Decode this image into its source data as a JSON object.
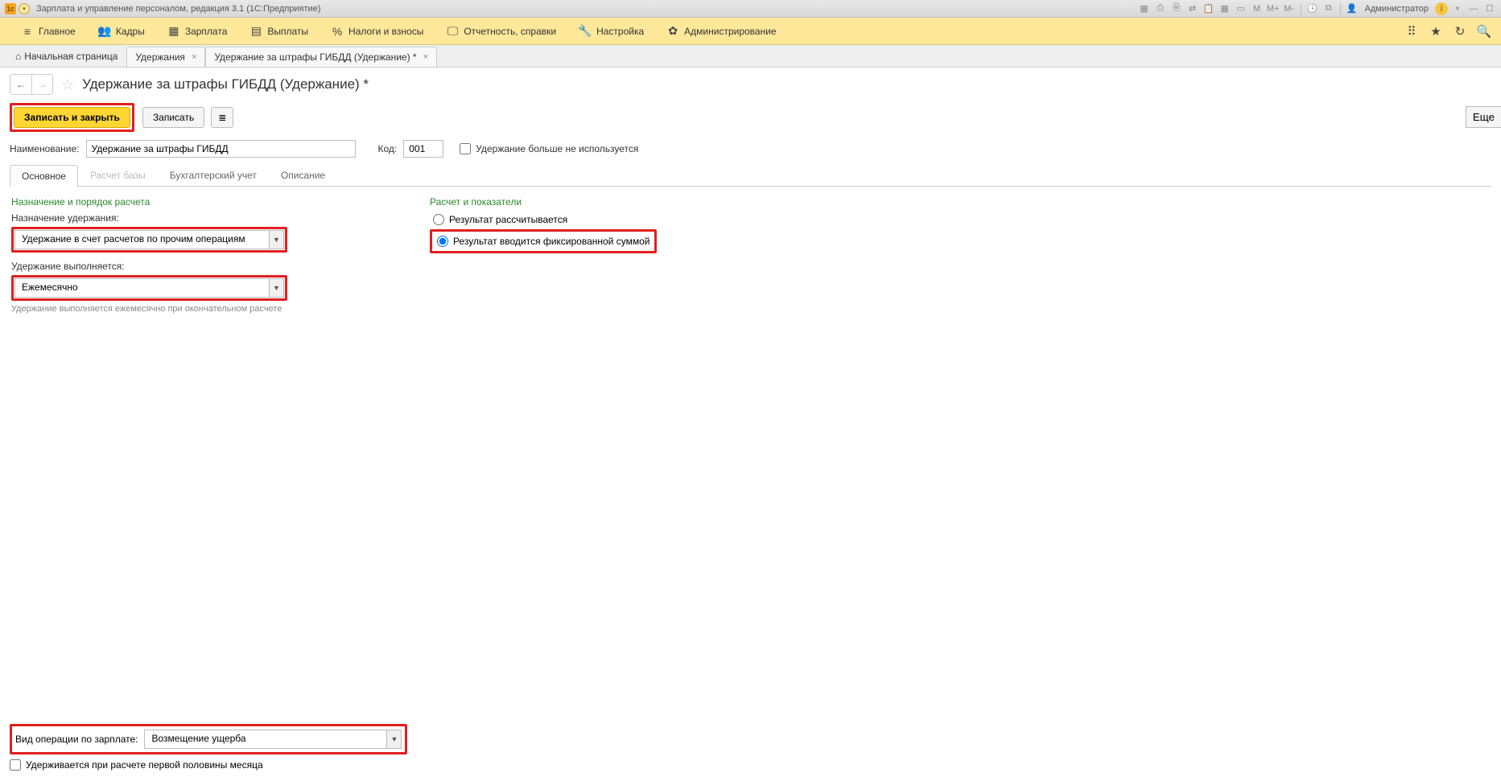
{
  "titlebar": {
    "app_icon_text": "1c",
    "title": "Зарплата и управление персоналом, редакция 3.1  (1С:Предприятие)",
    "user": "Администратор",
    "m_labels": [
      "M",
      "M+",
      "M-"
    ]
  },
  "mainnav": {
    "items": [
      {
        "icon": "≡",
        "label": "Главное"
      },
      {
        "icon": "👥",
        "label": "Кадры"
      },
      {
        "icon": "▦",
        "label": "Зарплата"
      },
      {
        "icon": "▤",
        "label": "Выплаты"
      },
      {
        "icon": "%",
        "label": "Налоги и взносы"
      },
      {
        "icon": "🖵",
        "label": "Отчетность, справки"
      },
      {
        "icon": "🔧",
        "label": "Настройка"
      },
      {
        "icon": "✿",
        "label": "Администрирование"
      }
    ]
  },
  "tabs": {
    "home": "Начальная страница",
    "items": [
      {
        "label": "Удержания"
      },
      {
        "label": "Удержание за штрафы ГИБДД (Удержание) *"
      }
    ]
  },
  "page": {
    "title": "Удержание за штрафы ГИБДД (Удержание) *",
    "more": "Еще"
  },
  "toolbar": {
    "save_close": "Записать и закрыть",
    "save": "Записать",
    "list_icon": "≣"
  },
  "form": {
    "name_label": "Наименование:",
    "name_value": "Удержание за штрафы ГИБДД",
    "code_label": "Код:",
    "code_value": "001",
    "disabled_label": "Удержание больше не используется"
  },
  "inner_tabs": [
    {
      "label": "Основное",
      "active": true
    },
    {
      "label": "Расчет базы",
      "disabled": true
    },
    {
      "label": "Бухгалтерский учет"
    },
    {
      "label": "Описание"
    }
  ],
  "main_tab": {
    "left_section_head": "Назначение и порядок расчета",
    "purpose_label": "Назначение удержания:",
    "purpose_value": "Удержание в счет расчетов по прочим операциям",
    "performed_label": "Удержание выполняется:",
    "performed_value": "Ежемесячно",
    "performed_hint": "Удержание выполняется ежемесячно при окончательном расчете",
    "right_section_head": "Расчет и показатели",
    "radio1": "Результат рассчитывается",
    "radio2": "Результат вводится фиксированной суммой"
  },
  "bottom": {
    "op_label": "Вид операции по зарплате:",
    "op_value": "Возмещение ущерба",
    "half_month_label": "Удерживается при расчете первой половины месяца"
  }
}
